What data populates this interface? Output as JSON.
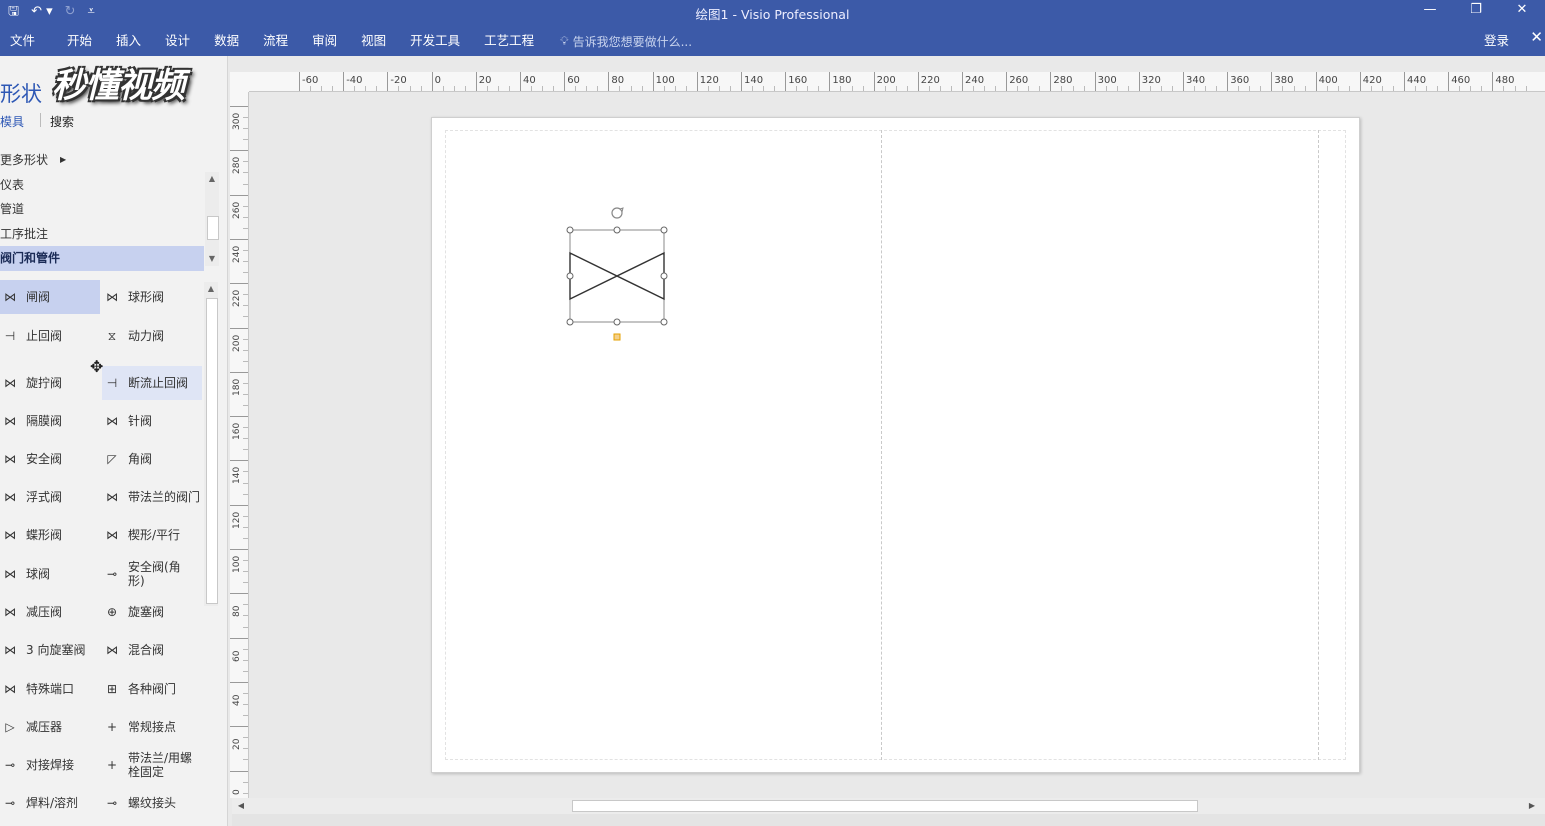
{
  "titlebar": {
    "title": "绘图1 - Visio Professional",
    "qat": [
      "save-icon",
      "undo-icon",
      "redo-icon",
      "customize-icon"
    ],
    "window_buttons": [
      "minimize-icon",
      "restore-icon",
      "close-icon"
    ]
  },
  "ribbon": {
    "tabs": [
      "文件",
      "开始",
      "插入",
      "设计",
      "数据",
      "流程",
      "审阅",
      "视图",
      "开发工具",
      "工艺工程"
    ],
    "tell_me": "告诉我您想要做什么...",
    "login": "登录"
  },
  "shapes_panel": {
    "title": "形状",
    "watermark": "秒懂视频",
    "sub_tabs": [
      "模具",
      "搜索"
    ],
    "more_shapes": "更多形状",
    "stencils": [
      "仪表",
      "管道",
      "工序批注",
      "阀门和管件"
    ],
    "selected_stencil": "阀门和管件",
    "items": [
      {
        "label": "闸阀",
        "icon": "⋈"
      },
      {
        "label": "球形阀",
        "icon": "⋈"
      },
      {
        "label": "止回阀",
        "icon": "⊣"
      },
      {
        "label": "动力阀",
        "icon": "⧖"
      },
      {
        "label": "旋拧阀",
        "icon": "⋈"
      },
      {
        "label": "断流止回阀",
        "icon": "⊣"
      },
      {
        "label": "隔膜阀",
        "icon": "⋈"
      },
      {
        "label": "针阀",
        "icon": "⋈"
      },
      {
        "label": "安全阀",
        "icon": "⋈"
      },
      {
        "label": "角阀",
        "icon": "◸"
      },
      {
        "label": "浮式阀",
        "icon": "⋈"
      },
      {
        "label": "带法兰的阀门",
        "icon": "⋈"
      },
      {
        "label": "蝶形阀",
        "icon": "⋈"
      },
      {
        "label": "楔形/平行",
        "icon": "⋈"
      },
      {
        "label": "球阀",
        "icon": "⋈"
      },
      {
        "label": "安全阀(角形)",
        "icon": "⊸"
      },
      {
        "label": "减压阀",
        "icon": "⋈"
      },
      {
        "label": "旋塞阀",
        "icon": "⊕"
      },
      {
        "label": "3 向旋塞阀",
        "icon": "⋈"
      },
      {
        "label": "混合阀",
        "icon": "⋈"
      },
      {
        "label": "特殊端口",
        "icon": "⋈"
      },
      {
        "label": "各种阀门",
        "icon": "⊞"
      },
      {
        "label": "减压器",
        "icon": "▷"
      },
      {
        "label": "常规接点",
        "icon": "+"
      },
      {
        "label": "对接焊接",
        "icon": "⊸"
      },
      {
        "label": "带法兰/用螺栓固定",
        "icon": "+"
      },
      {
        "label": "焊料/溶剂",
        "icon": "⊸"
      },
      {
        "label": "螺纹接头",
        "icon": "⊸"
      }
    ]
  },
  "rulers": {
    "horizontal": [
      "-60",
      "-40",
      "-20",
      "0",
      "20",
      "40",
      "60",
      "80",
      "100",
      "120",
      "140",
      "160",
      "180",
      "200",
      "220",
      "240",
      "260",
      "280",
      "300",
      "320",
      "340",
      "360",
      "380",
      "400",
      "420",
      "440",
      "460",
      "480"
    ],
    "vertical": [
      "300",
      "280",
      "260",
      "240",
      "220",
      "200",
      "180",
      "160",
      "140",
      "120",
      "100",
      "80",
      "60",
      "40",
      "20",
      "0"
    ]
  },
  "colors": {
    "accent": "#3c5aa8",
    "selection": "#c7d1ef",
    "handle": "#e5a000"
  }
}
